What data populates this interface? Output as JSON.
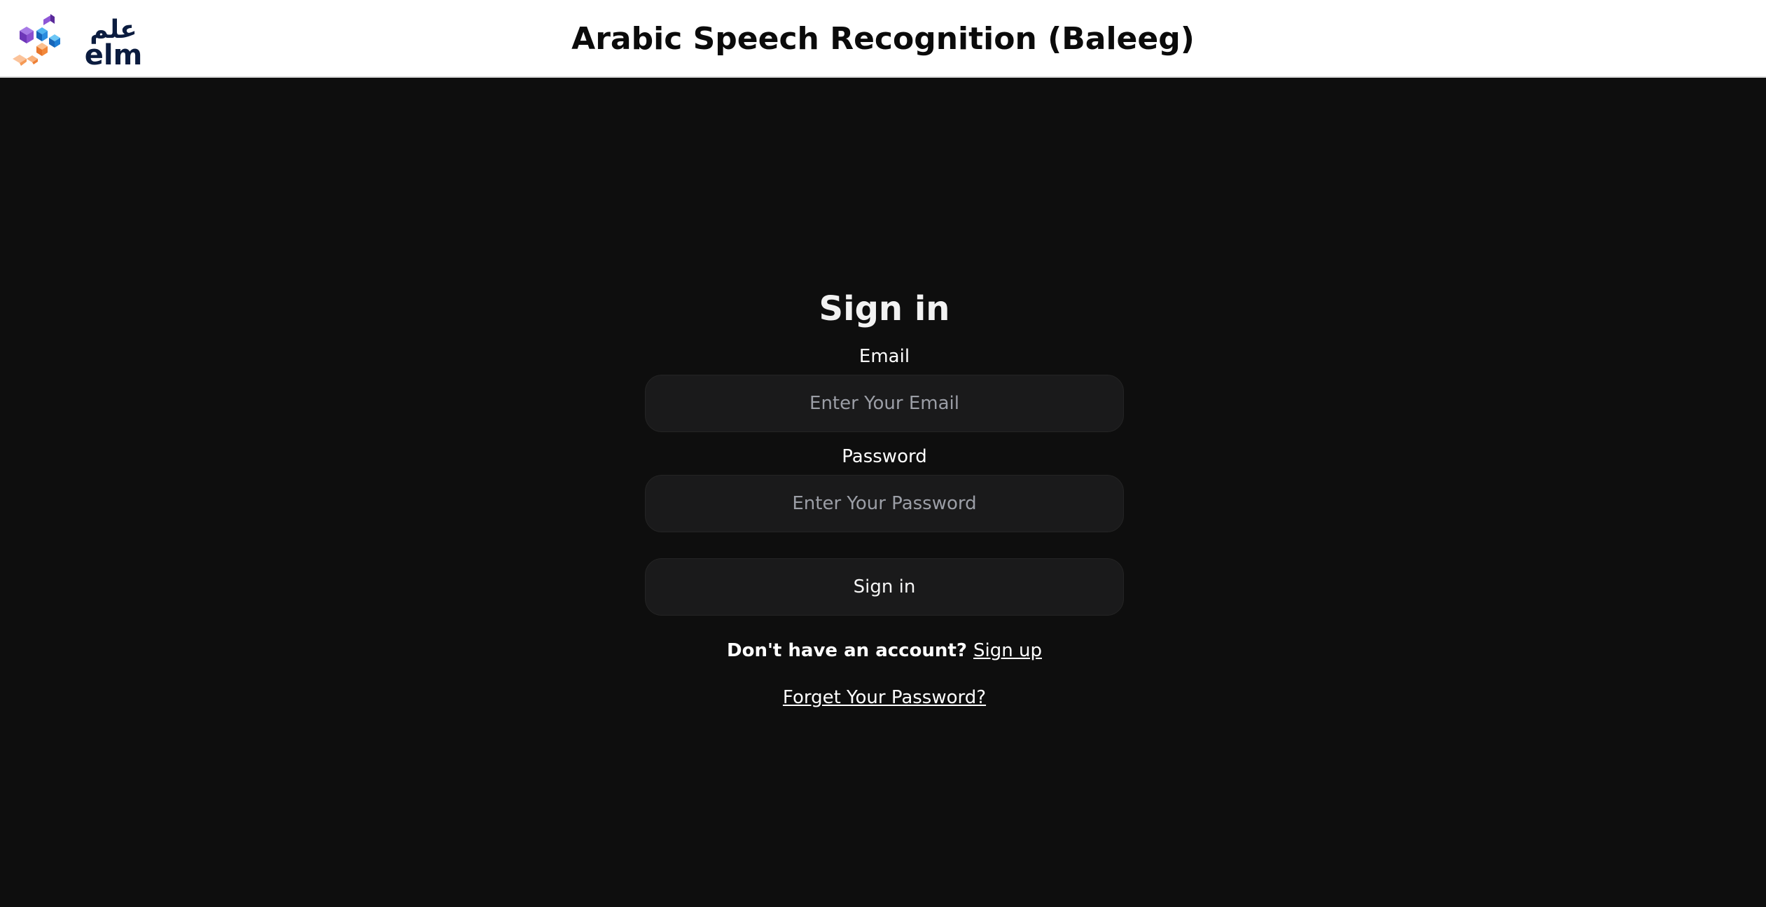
{
  "header": {
    "title": "Arabic Speech Recognition (Baleeg)",
    "logo": {
      "arabic_text": "علم",
      "latin_text": "elm",
      "colors": {
        "purple": "#7b3fc4",
        "blue": "#1d7fd6",
        "orange": "#f2883a",
        "peach": "#f8b07a",
        "navy": "#0b1c3f"
      }
    }
  },
  "signin": {
    "title": "Sign in",
    "email_label": "Email",
    "email_placeholder": "Enter Your Email",
    "email_value": "",
    "password_label": "Password",
    "password_placeholder": "Enter Your Password",
    "password_value": "",
    "button_label": "Sign in",
    "no_account_text": "Don't have an account?",
    "signup_link": "Sign up",
    "forgot_link": "Forget Your Password?"
  },
  "theme": {
    "page_background": "#0e0e0e",
    "header_background": "#ffffff",
    "field_background": "#1a1a1b"
  }
}
